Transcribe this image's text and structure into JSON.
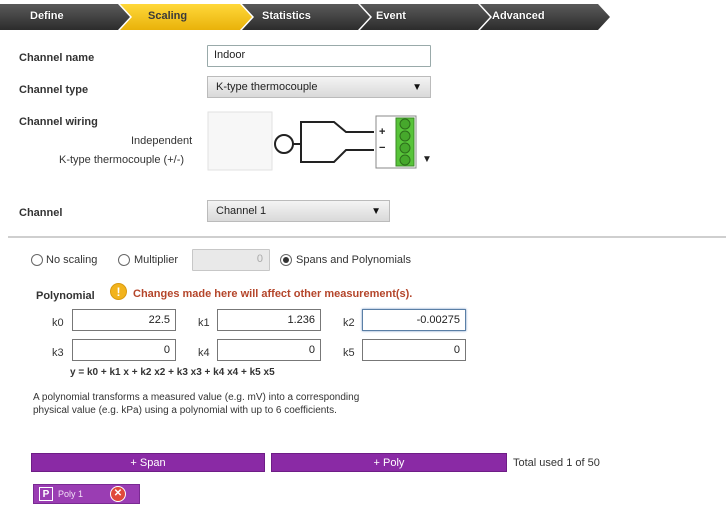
{
  "tabs": [
    {
      "label": "Define"
    },
    {
      "label": "Scaling",
      "active": true
    },
    {
      "label": "Statistics"
    },
    {
      "label": "Event"
    },
    {
      "label": "Advanced"
    }
  ],
  "channel": {
    "name_label": "Channel name",
    "name_value": "Indoor",
    "type_label": "Channel type",
    "type_value": "K-type thermocouple",
    "wiring_label": "Channel wiring",
    "wiring_mode": "Independent",
    "wiring_desc": "K-type thermocouple (+/-)",
    "terminal_plus": "+",
    "terminal_minus": "−",
    "channel_label": "Channel",
    "channel_value": "Channel 1"
  },
  "scaling": {
    "opt_none": "No scaling",
    "opt_multiplier": "Multiplier",
    "multiplier_value": "0",
    "opt_spans": "Spans and Polynomials",
    "selected": "Spans and Polynomials"
  },
  "polynomial": {
    "label": "Polynomial",
    "warning": "Changes made here will affect other measurement(s).",
    "coefficients": [
      {
        "name": "k0",
        "value": "22.5"
      },
      {
        "name": "k1",
        "value": "1.236"
      },
      {
        "name": "k2",
        "value": "-0.00275"
      },
      {
        "name": "k3",
        "value": "0"
      },
      {
        "name": "k4",
        "value": "0"
      },
      {
        "name": "k5",
        "value": "0"
      }
    ],
    "formula": "y = k0 + k1 x + k2 x2 + k3 x3 + k4 x4 + k5 x5",
    "help_line1": "A polynomial transforms a measured value (e.g. mV) into a corresponding",
    "help_line2": "physical value (e.g. kPa) using a polynomial with up to 6 coefficients."
  },
  "actions": {
    "add_span": "+ Span",
    "add_poly": "+ Poly",
    "total_used": "Total used 1 of 50"
  },
  "chip": {
    "badge": "P",
    "label": "Poly 1"
  },
  "colors": {
    "active_tab": "#f2c316",
    "tab_dark": "#3b3b3b",
    "button_purple": "#8a2aa5",
    "terminal_green": "#58c43a",
    "warning_orange": "#f2b31c",
    "warning_text": "#b4452a"
  }
}
